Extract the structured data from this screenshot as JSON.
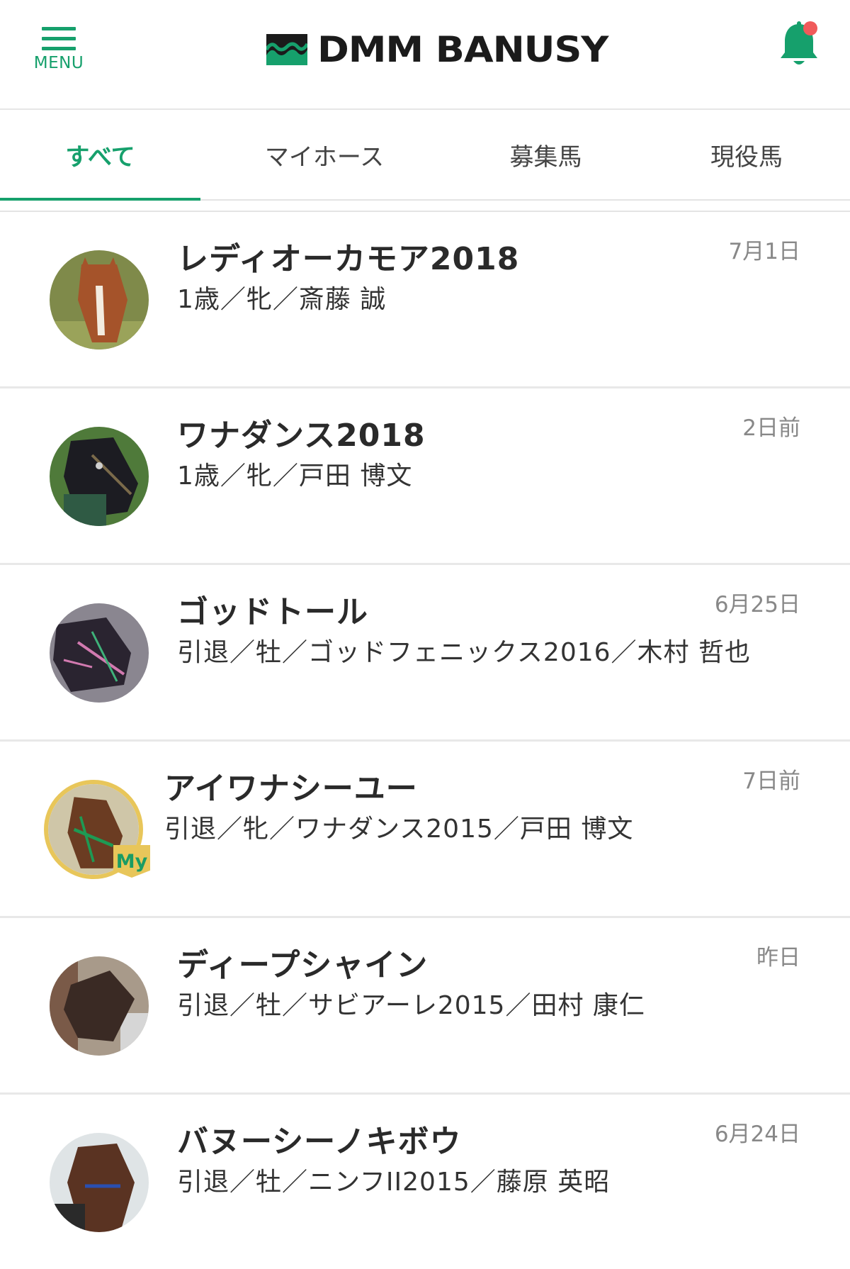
{
  "header": {
    "menu_label": "MENU",
    "logo_text": "DMM BANUSY",
    "brand_color": "#16a06c",
    "notification_color": "#f05a5a"
  },
  "tabs": [
    {
      "label": "すべて",
      "active": true
    },
    {
      "label": "マイホース",
      "active": false
    },
    {
      "label": "募集馬",
      "active": false
    },
    {
      "label": "現役馬",
      "active": false
    }
  ],
  "horses": [
    {
      "name": "レディオーカモア2018",
      "meta": "1歳／牝／斎藤 誠",
      "date": "7月1日",
      "my": false
    },
    {
      "name": "ワナダンス2018",
      "meta": "1歳／牝／戸田 博文",
      "date": "2日前",
      "my": false
    },
    {
      "name": "ゴッドトール",
      "meta": "引退／牡／ゴッドフェニックス2016／木村 哲也",
      "date": "6月25日",
      "my": false
    },
    {
      "name": "アイワナシーユー",
      "meta": "引退／牝／ワナダンス2015／戸田 博文",
      "date": "7日前",
      "my": true,
      "badge": "My"
    },
    {
      "name": "ディープシャイン",
      "meta": "引退／牡／サビアーレ2015／田村 康仁",
      "date": "昨日",
      "my": false
    },
    {
      "name": "バヌーシーノキボウ",
      "meta": "引退／牡／ニンフII2015／藤原 英昭",
      "date": "6月24日",
      "my": false
    }
  ]
}
